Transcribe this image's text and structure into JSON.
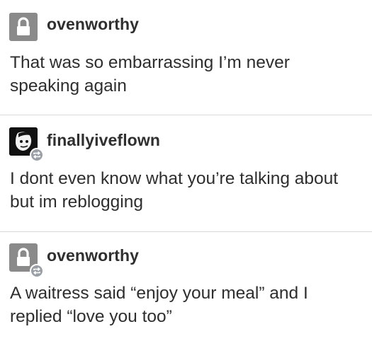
{
  "posts": [
    {
      "username": "ovenworthy",
      "avatar_icon": "lock-icon",
      "reblog": false,
      "text": "That was so embarrassing I’m never speaking again"
    },
    {
      "username": "finallyiveflown",
      "avatar_icon": "portrait-avatar",
      "reblog": true,
      "text": "I dont even know what you’re talking about but im reblogging"
    },
    {
      "username": "ovenworthy",
      "avatar_icon": "lock-icon",
      "reblog": true,
      "text": "A waitress said “enjoy your meal” and I replied “love you too”"
    }
  ],
  "colors": {
    "lock_avatar_bg": "#8a8a8a",
    "reblog_badge": "#9aa0a6",
    "divider": "#d9d9d9",
    "text": "#2e2e2e"
  }
}
